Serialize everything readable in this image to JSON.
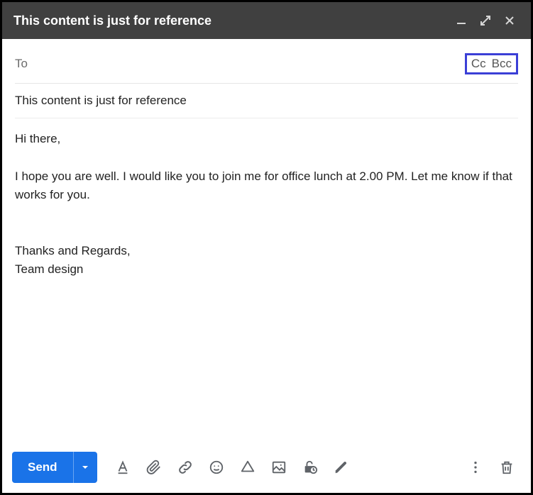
{
  "window": {
    "title": "This content is just for reference"
  },
  "recipients": {
    "to_label": "To",
    "to_value": "",
    "cc_label": "Cc",
    "bcc_label": "Bcc"
  },
  "subject": {
    "value": "This content is just for reference"
  },
  "body": {
    "text": "Hi there,\n\nI hope you are well. I would like you to join me for office lunch at 2.00 PM. Let me know if that works for you.\n\n\nThanks and Regards,\nTeam design"
  },
  "toolbar": {
    "send_label": "Send"
  }
}
